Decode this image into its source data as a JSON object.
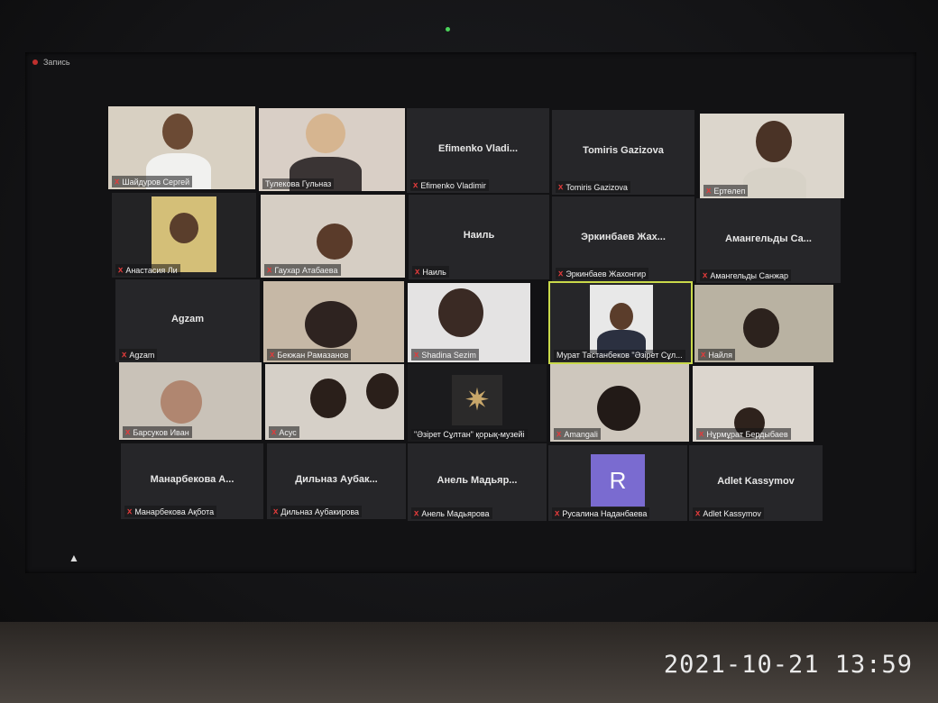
{
  "recording_label": "Запись",
  "timestamp": "2021-10-21 13:59",
  "avatar_letter": "R",
  "participants": [
    {
      "name": "Шайдуров Сергей",
      "center": "",
      "muted": true,
      "video": true
    },
    {
      "name": "Тулекова Гульназ",
      "center": "",
      "muted": false,
      "video": true
    },
    {
      "name": "Efimenko Vladimir",
      "center": "Efimenko Vladi...",
      "muted": true,
      "video": false
    },
    {
      "name": "Tomiris Gazizova",
      "center": "Tomiris Gazizova",
      "muted": true,
      "video": false
    },
    {
      "name": "Ертөлеп",
      "center": "",
      "muted": true,
      "video": true
    },
    {
      "name": "Анастасия Ли",
      "center": "",
      "muted": true,
      "video": true
    },
    {
      "name": "Гаухар Атабаева",
      "center": "",
      "muted": true,
      "video": true
    },
    {
      "name": "Наиль",
      "center": "Наиль",
      "muted": true,
      "video": false
    },
    {
      "name": "Эркинбаев Жахонгир",
      "center": "Эркинбаев Жах...",
      "muted": true,
      "video": false
    },
    {
      "name": "Амангельды Санжар",
      "center": "Амангельды Са...",
      "muted": true,
      "video": false
    },
    {
      "name": "Agzam",
      "center": "Agzam",
      "muted": true,
      "video": false
    },
    {
      "name": "Бекжан Рамазанов",
      "center": "",
      "muted": true,
      "video": true
    },
    {
      "name": "Shadina Sezim",
      "center": "",
      "muted": true,
      "video": true
    },
    {
      "name": "Мурат Тастанбеков \"Әзірет Сұл...",
      "center": "",
      "muted": false,
      "video": true
    },
    {
      "name": "Найля",
      "center": "",
      "muted": true,
      "video": true
    },
    {
      "name": "Барсуков Иван",
      "center": "",
      "muted": true,
      "video": true
    },
    {
      "name": "Асус",
      "center": "",
      "muted": true,
      "video": true
    },
    {
      "name": "\"Әзірет Сұлтан\" қорық-музейі",
      "center": "",
      "muted": false,
      "video": false
    },
    {
      "name": "Amangali",
      "center": "",
      "muted": true,
      "video": true
    },
    {
      "name": "Нұрмұрат Бердыбаев",
      "center": "",
      "muted": true,
      "video": true
    },
    {
      "name": "Манарбекова Ақбота",
      "center": "Манарбекова А...",
      "muted": true,
      "video": false
    },
    {
      "name": "Дильназ Аубакирова",
      "center": "Дильназ Аубак...",
      "muted": true,
      "video": false
    },
    {
      "name": "Анель Мадьярова",
      "center": "Анель Мадьяр...",
      "muted": true,
      "video": false
    },
    {
      "name": "Русалина Наданбаева",
      "center": "",
      "muted": true,
      "video": false
    },
    {
      "name": "Adlet Kassymov",
      "center": "Adlet Kassymov",
      "muted": true,
      "video": false
    }
  ]
}
